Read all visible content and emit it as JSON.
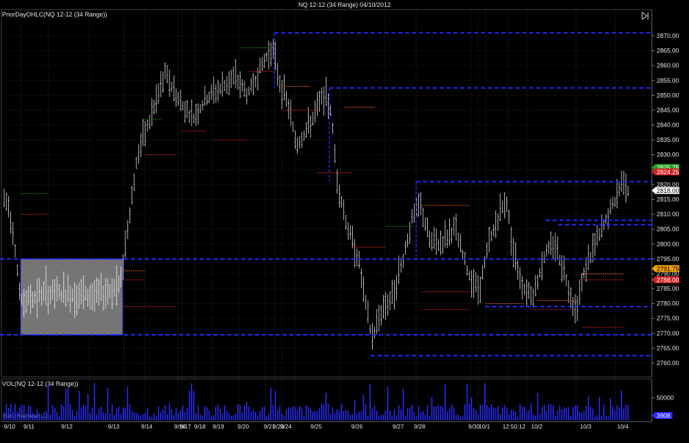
{
  "window": {
    "title": "NQ 12-12 (34 Range)  04/10/2012"
  },
  "panels": {
    "price_label": "PriorDayOHLC(NQ 12-12 (34 Range))",
    "volume_label": "VOL(NQ 12-12 (34 Range))",
    "copyright": "© 2012 NinjaTrader, LLC"
  },
  "icons": {
    "scroll_end": "scroll-to-end-icon"
  },
  "colors": {
    "background": "#000000",
    "bars": "#e8e8e8",
    "levels": "#1f2bff",
    "volume": "#2a2aff",
    "badge_up": "#20a020",
    "badge_down": "#d02020",
    "badge_orange": "#f0a000",
    "badge_last": "#ffffff"
  },
  "chart_data": {
    "type": "ohlc",
    "price_axis": {
      "min": 2756,
      "max": 2875,
      "ticks": [
        "2870.00",
        "2865.00",
        "2860.00",
        "2855.00",
        "2850.00",
        "2845.00",
        "2840.00",
        "2835.00",
        "2830.00",
        "2825.00",
        "2820.00",
        "2815.00",
        "2810.00",
        "2805.00",
        "2800.00",
        "2795.00",
        "2790.00",
        "2785.00",
        "2780.00",
        "2775.00",
        "2770.00",
        "2765.00",
        "2760.00"
      ]
    },
    "volume_axis": {
      "ticks": [
        "50000"
      ],
      "max": 100000
    },
    "x_labels": [
      "9/10",
      "9/11",
      "9/12",
      "9/13",
      "9/14",
      "9/16",
      "9/17",
      "9/18",
      "9/19",
      "9/20",
      "9/21",
      "9/23",
      "9/24",
      "9/25",
      "9/26",
      "9/27",
      "9/28",
      "9/30",
      "10/1",
      "12:50:12",
      "10/2",
      "10/3",
      "10/4"
    ],
    "price_badges": [
      {
        "label": "2825.75",
        "kind": "up"
      },
      {
        "label": "2824.25",
        "kind": "down"
      },
      {
        "label": "2818.00",
        "kind": "last"
      },
      {
        "label": "2791.75",
        "kind": "orange"
      },
      {
        "label": "2788.00",
        "kind": "down"
      }
    ],
    "volume_badge": "3908",
    "levels": [
      2871,
      2852.5,
      2821,
      2808,
      2806.5,
      2795,
      2779,
      2769.5,
      2762.5
    ],
    "highlight_zone": {
      "from": "9/11",
      "to": "9/13",
      "low": 2769.5,
      "high": 2795
    },
    "grid": true
  }
}
